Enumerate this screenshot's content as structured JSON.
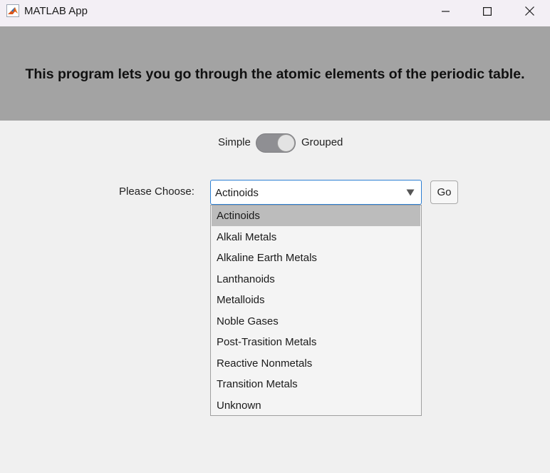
{
  "window": {
    "title": "MATLAB App"
  },
  "banner": {
    "text": "This program lets you go through the atomic elements of the periodic table."
  },
  "switch": {
    "left_label": "Simple",
    "right_label": "Grouped",
    "state": "Grouped"
  },
  "chooser": {
    "label": "Please Choose:",
    "selected": "Actinoids",
    "options": [
      "Actinoids",
      "Alkali Metals",
      "Alkaline Earth Metals",
      "Lanthanoids",
      "Metalloids",
      "Noble Gases",
      "Post-Trasition Metals",
      "Reactive Nonmetals",
      "Transition Metals",
      "Unknown"
    ],
    "go_label": "Go"
  },
  "colors": {
    "banner": "#a3a3a3",
    "dropdown_focus": "#2d7fd3",
    "selected_row": "#bcbcbc"
  }
}
